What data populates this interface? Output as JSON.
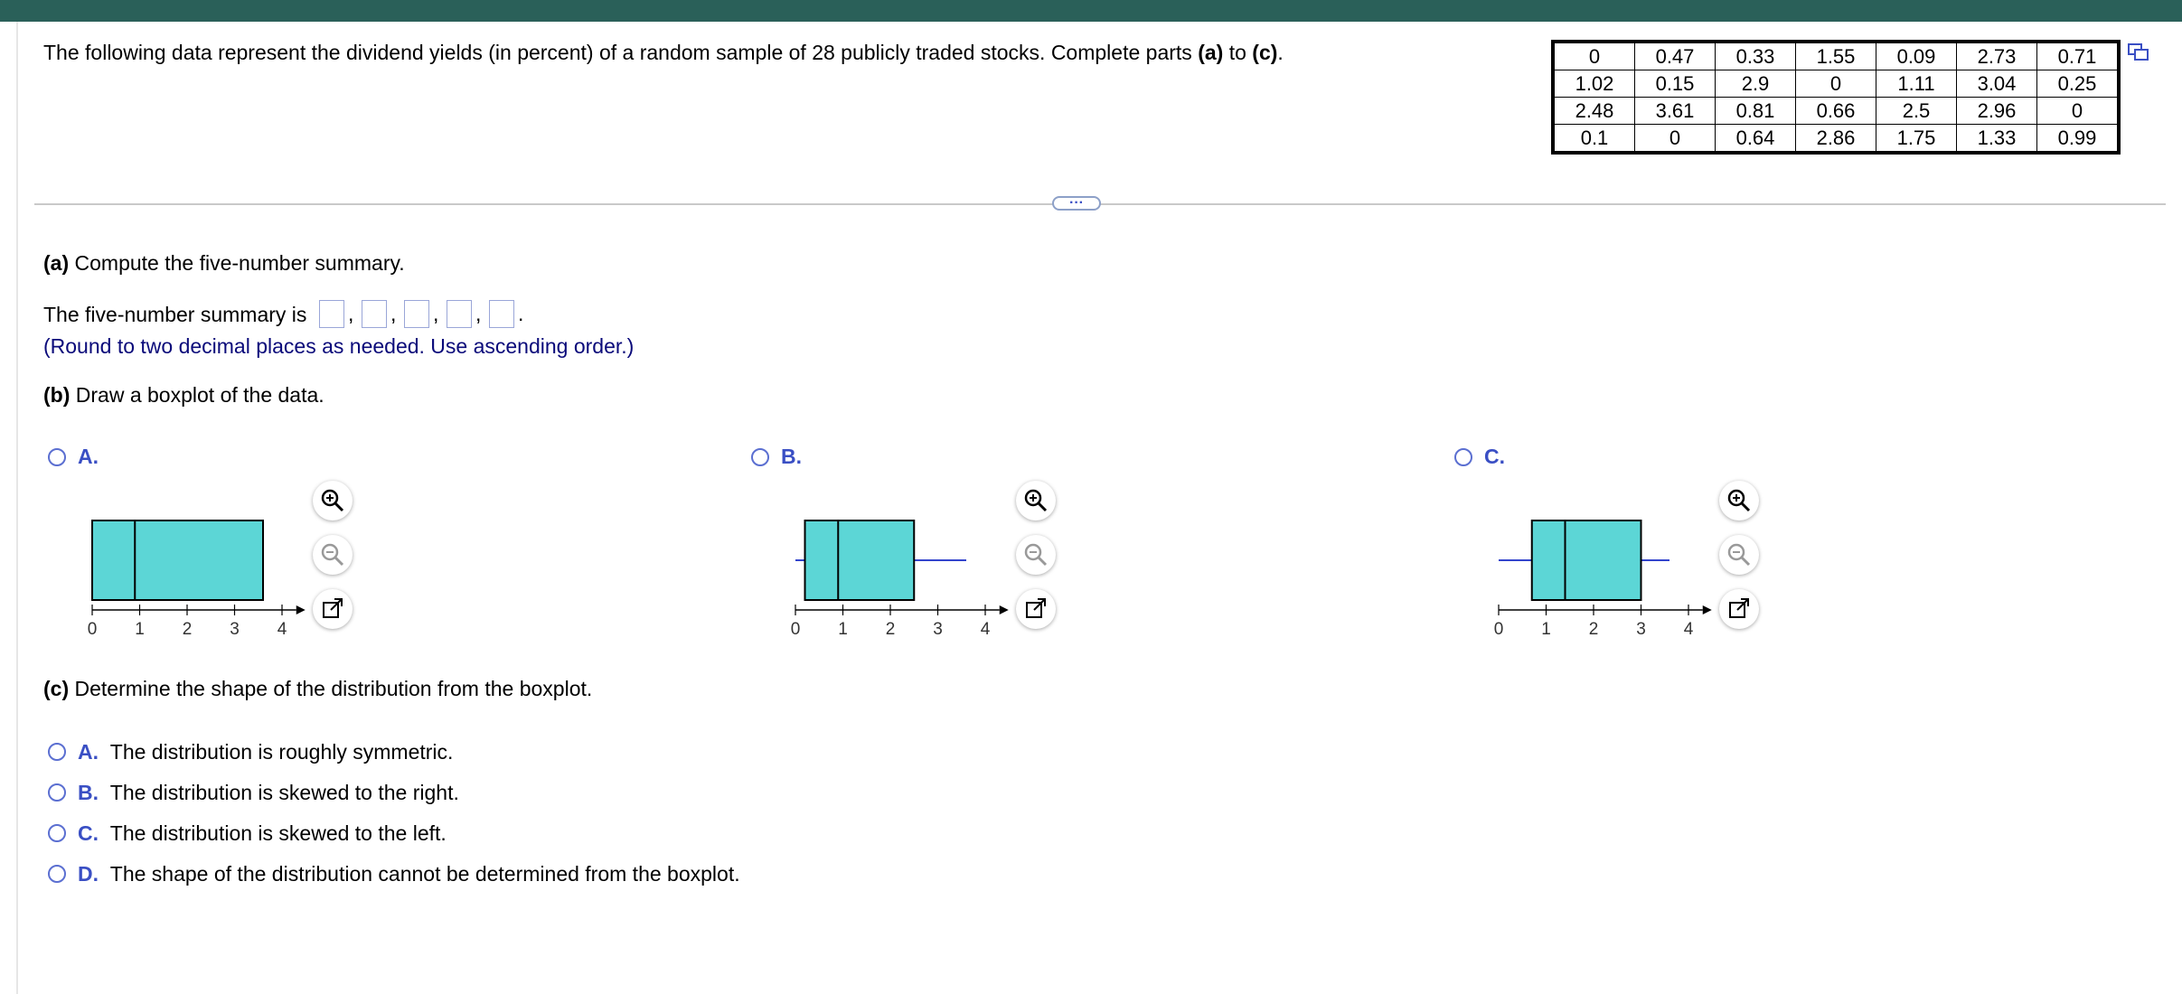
{
  "question": {
    "intro": "The following data represent  the dividend yields (in percent) of a random sample of 28 publicly traded stocks. Complete parts ",
    "intro_a": "(a)",
    "intro_to": " to ",
    "intro_c": "(c)",
    "intro_end": ".",
    "data_table": [
      [
        "0",
        "0.47",
        "0.33",
        "1.55",
        "0.09",
        "2.73",
        "0.71"
      ],
      [
        "1.02",
        "0.15",
        "2.9",
        "0",
        "1.11",
        "3.04",
        "0.25"
      ],
      [
        "2.48",
        "3.61",
        "0.81",
        "0.66",
        "2.5",
        "2.96",
        "0"
      ],
      [
        "0.1",
        "0",
        "0.64",
        "2.86",
        "1.75",
        "1.33",
        "0.99"
      ]
    ],
    "more_button": "···"
  },
  "part_a": {
    "label": "(a)",
    "text": " Compute the five-number summary.",
    "summary_prefix": "The five-number summary is",
    "comma": ",",
    "period": ".",
    "hint": "(Round to two decimal places as needed. Use ascending order.)"
  },
  "part_b": {
    "label": "(b)",
    "text": " Draw a boxplot of the data.",
    "options": [
      {
        "letter": "A.",
        "min": 0,
        "q1": 0.9,
        "median": 0.9,
        "q3": 3.6,
        "max": 3.6,
        "whiskers": false
      },
      {
        "letter": "B.",
        "min": 0,
        "q1": 0.2,
        "median": 0.9,
        "q3": 2.5,
        "max": 3.6,
        "whiskers": true
      },
      {
        "letter": "C.",
        "min": 0,
        "q1": 0.7,
        "median": 1.4,
        "q3": 3.0,
        "max": 3.6,
        "whiskers": true
      }
    ],
    "axis_ticks": [
      "0",
      "1",
      "2",
      "3",
      "4"
    ]
  },
  "part_c": {
    "label": "(c)",
    "text": " Determine the shape of the distribution from the boxplot.",
    "options": [
      {
        "letter": "A.",
        "text": "The distribution is roughly symmetric."
      },
      {
        "letter": "B.",
        "text": "The distribution is skewed to the right."
      },
      {
        "letter": "C.",
        "text": "The distribution is skewed to the left."
      },
      {
        "letter": "D.",
        "text": "The shape of the distribution cannot be determined from the boxplot."
      }
    ]
  },
  "colors": {
    "topbar": "#2a6059",
    "box_fill": "#5cd6d6",
    "whisker": "#3344cc",
    "option_letter": "#3a4fc4",
    "hint": "#0a0a7a"
  },
  "icons": {
    "zoom_in": "zoom-in-icon",
    "zoom_out": "zoom-out-icon",
    "popout": "popout-icon",
    "copy_table": "copy-table-icon"
  }
}
